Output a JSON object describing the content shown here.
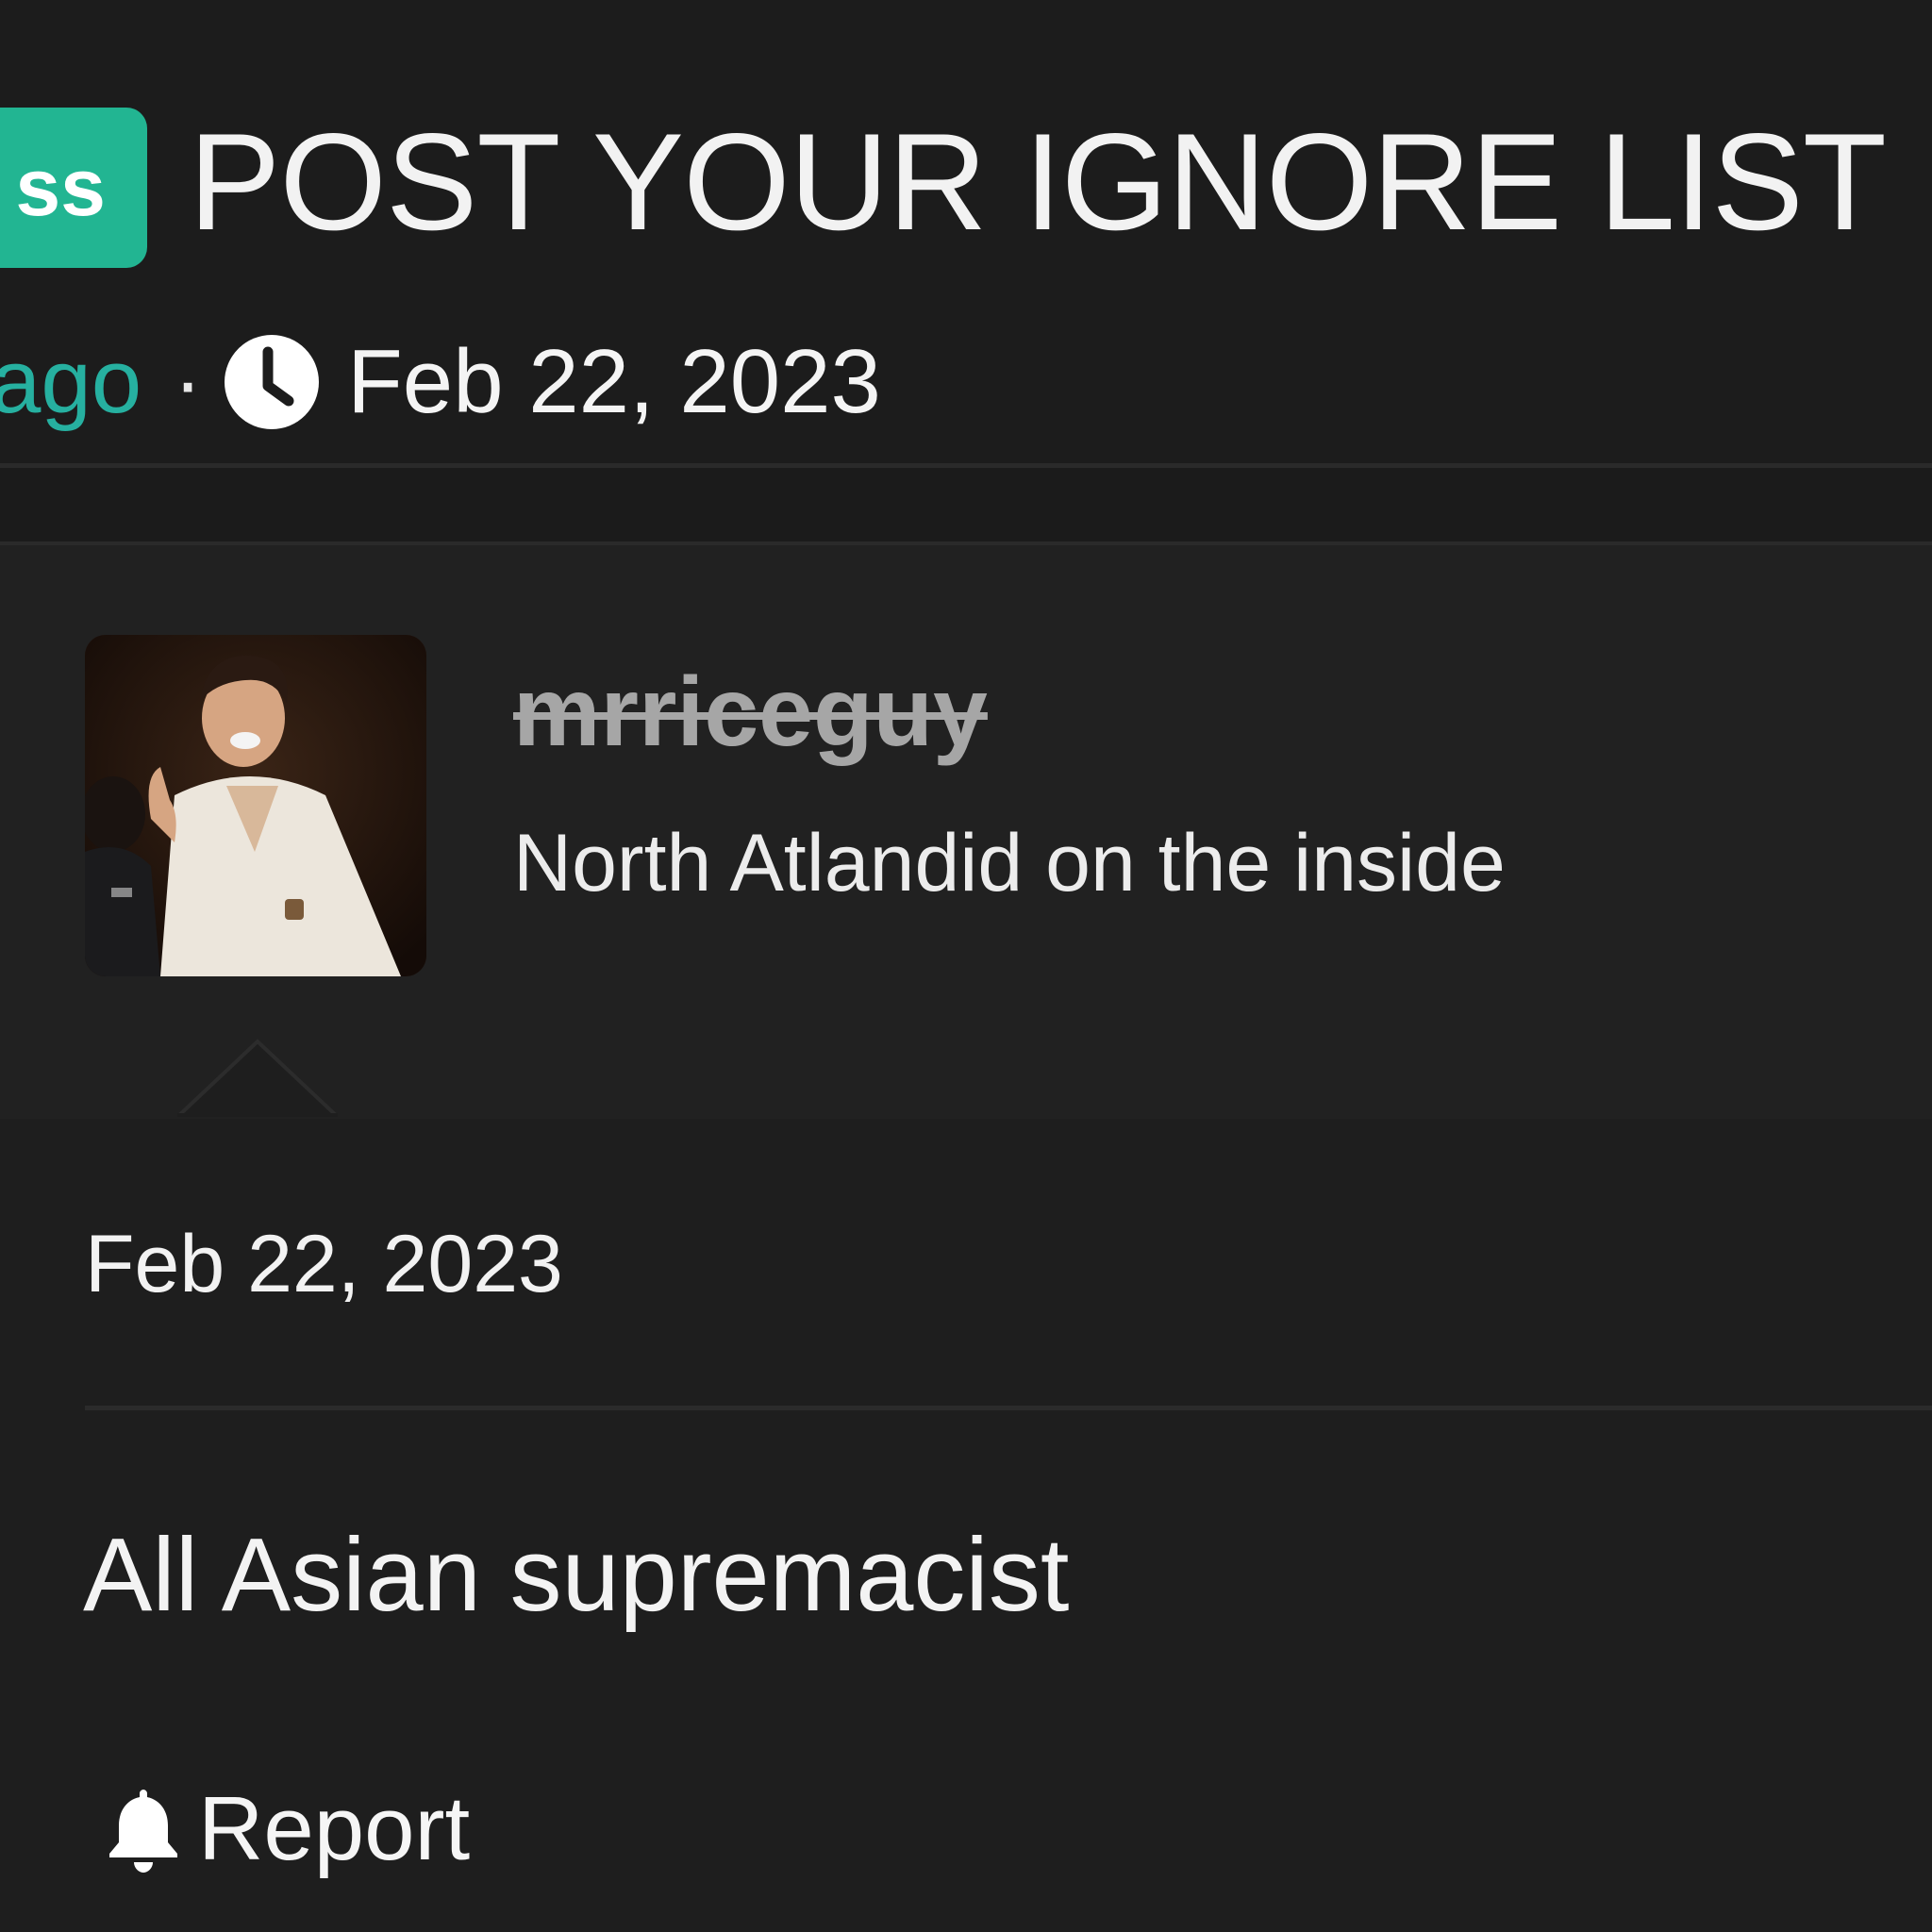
{
  "thread": {
    "prefix": "ss",
    "title": "POST YOUR IGNORE LIST",
    "author_fragment": "ago",
    "separator": "·",
    "date": "Feb 22, 2023"
  },
  "post": {
    "username": "mrriceguy",
    "user_title": "North Atlandid on the inside",
    "date": "Feb 22, 2023",
    "text": "All Asian supremacist",
    "report_label": "Report"
  },
  "icons": {
    "clock": "clock-icon",
    "bell": "bell-icon"
  },
  "colors": {
    "background": "#1e1e1e",
    "badge": "#22b592",
    "author_link": "#26b0a0",
    "username_struck": "#a6a6a6",
    "text": "#f0f0f0"
  }
}
